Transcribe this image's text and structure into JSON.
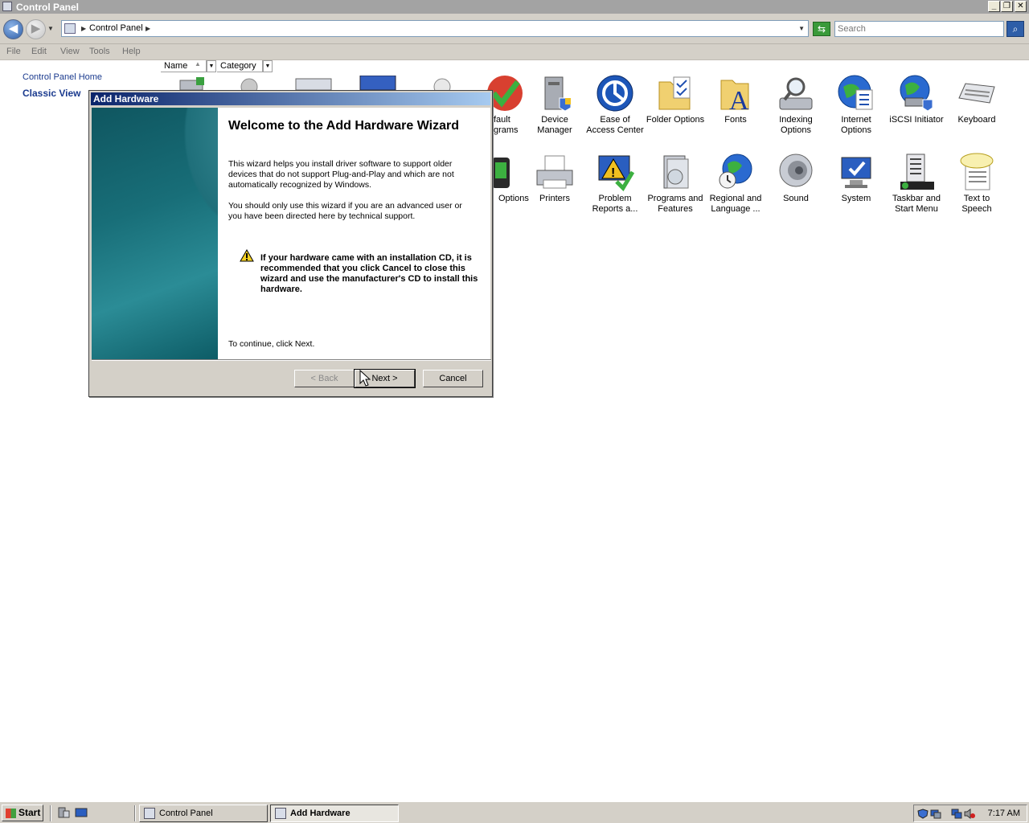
{
  "window": {
    "title": "Control Panel"
  },
  "address": {
    "location": "Control Panel",
    "search_placeholder": "Search"
  },
  "menu": [
    "File",
    "Edit",
    "View",
    "Tools",
    "Help"
  ],
  "left_pane": {
    "home_link": "Control Panel Home",
    "classic_view": "Classic View"
  },
  "columns": {
    "name": "Name",
    "category": "Category"
  },
  "items_row1": [
    {
      "label": "fault\ngrams",
      "icon": "default-programs-icon"
    },
    {
      "label": "Device\nManager",
      "icon": "device-manager-icon"
    },
    {
      "label": "Ease of\nAccess Center",
      "icon": "ease-of-access-icon"
    },
    {
      "label": "Folder Options",
      "icon": "folder-options-icon"
    },
    {
      "label": "Fonts",
      "icon": "fonts-icon"
    },
    {
      "label": "Indexing\nOptions",
      "icon": "indexing-options-icon"
    },
    {
      "label": "Internet\nOptions",
      "icon": "internet-options-icon"
    },
    {
      "label": "iSCSI Initiator",
      "icon": "iscsi-initiator-icon"
    },
    {
      "label": "Keyboard",
      "icon": "keyboard-icon"
    }
  ],
  "items_row2": [
    {
      "label": "Options",
      "icon": "power-options-icon"
    },
    {
      "label": "Printers",
      "icon": "printers-icon"
    },
    {
      "label": "Problem\nReports a...",
      "icon": "problem-reports-icon"
    },
    {
      "label": "Programs and\nFeatures",
      "icon": "programs-features-icon"
    },
    {
      "label": "Regional and\nLanguage ...",
      "icon": "regional-language-icon"
    },
    {
      "label": "Sound",
      "icon": "sound-icon"
    },
    {
      "label": "System",
      "icon": "system-icon"
    },
    {
      "label": "Taskbar and\nStart Menu",
      "icon": "taskbar-start-menu-icon"
    },
    {
      "label": "Text to\nSpeech",
      "icon": "text-to-speech-icon"
    }
  ],
  "dialog": {
    "title": "Add Hardware",
    "heading": "Welcome to the Add Hardware Wizard",
    "para1": "This wizard helps you install driver software to support older devices that do not support Plug-and-Play and which are not automatically recognized by Windows.",
    "para2": "You should only use this wizard if you are an advanced user or you have been directed here by technical support.",
    "warning": "If your hardware came with an installation CD, it is recommended that you click Cancel to close this wizard and use the manufacturer's CD to install this hardware.",
    "continue": "To continue, click Next.",
    "back": "< Back",
    "next": "Next >",
    "cancel": "Cancel"
  },
  "taskbar": {
    "start": "Start",
    "tasks": [
      "Control Panel",
      "Add Hardware"
    ],
    "clock": "7:17 AM"
  }
}
